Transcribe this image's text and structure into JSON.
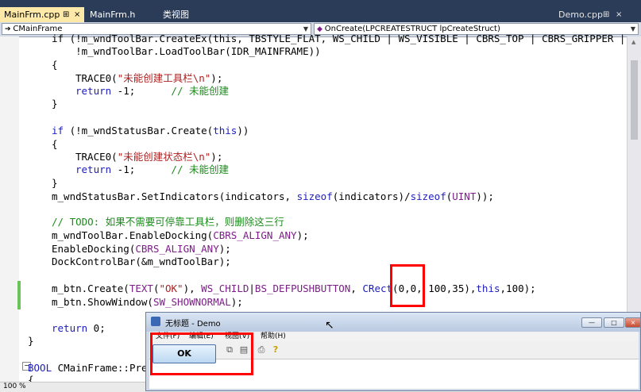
{
  "tabs": [
    {
      "label": "MainFrm.cpp",
      "pin": "⊞",
      "close": "×"
    },
    {
      "label": "MainFrm.h"
    },
    {
      "label": "类视图"
    }
  ],
  "file_tab": {
    "label": "Demo.cpp",
    "pin": "⊞",
    "close": "×"
  },
  "nav": {
    "class_combo": "CMainFrame",
    "method_combo": "OnCreate(LPCREATESTRUCT lpCreateStruct)"
  },
  "code": {
    "l0": "if (!m_wndToolBar.CreateEx(this, TBSTYLE_FLAT, WS_CHILD | WS_VISIBLE | CBRS_TOP | CBRS_GRIPPER |",
    "l1": "    !m_wndToolBar.LoadToolBar(IDR_MAINFRAME))",
    "l2": "{",
    "l3_fn": "TRACE0(",
    "l3_str": "\"未能创建工具栏\\n\"",
    "l3_end": ");",
    "l4_kw": "return",
    "l4_rest": " -1;      ",
    "l4_cm": "// 未能创建",
    "l5": "}",
    "l7_kw": "if",
    "l7_a": " (!m_wndStatusBar.Create(",
    "l7_this": "this",
    "l7_b": "))",
    "l8": "{",
    "l9_fn": "TRACE0(",
    "l9_str": "\"未能创建状态栏\\n\"",
    "l9_end": ");",
    "l10_kw": "return",
    "l10_rest": " -1;      ",
    "l10_cm": "// 未能创建",
    "l11": "}",
    "l12_a": "m_wndStatusBar.SetIndicators(indicators, ",
    "l12_kw1": "sizeof",
    "l12_b": "(indicators)/",
    "l12_kw2": "sizeof",
    "l12_c": "(",
    "l12_mc": "UINT",
    "l12_d": "));",
    "l14_cm": "// TODO: 如果不需要可停靠工具栏，则删除这三行",
    "l15_a": "m_wndToolBar.EnableDocking(",
    "l15_mc": "CBRS_ALIGN_ANY",
    "l15_b": ");",
    "l16_a": "EnableDocking(",
    "l16_mc": "CBRS_ALIGN_ANY",
    "l16_b": ");",
    "l17": "DockControlBar(&m_wndToolBar);",
    "l19_a": "m_btn.Create(",
    "l19_mc1": "TEXT",
    "l19_b": "(",
    "l19_str": "\"OK\"",
    "l19_c": "), ",
    "l19_mc2": "WS_CHILD",
    "l19_d": "|",
    "l19_mc3": "BS_DEFPUSHBUTTON",
    "l19_e": ", ",
    "l19_kw": "CRect",
    "l19_f": "(0,0, 100,35),",
    "l19_this": "this",
    "l19_g": ",100);",
    "l20_a": "m_btn.ShowWindow(",
    "l20_mc": "SW_SHOWNORMAL",
    "l20_b": ");",
    "l22_kw": "return",
    "l22_rest": " 0;",
    "l23": "}",
    "l25_kw": "BOOL",
    "l25_rest": " CMainFrame::Pre",
    "l26": "{"
  },
  "demo_window": {
    "title": "无标题 - Demo",
    "menu": [
      "文件(F)",
      "编辑(E)",
      "视图(V)",
      "帮助(H)"
    ],
    "ok_button": "OK",
    "min": "—",
    "max": "□",
    "close": "×"
  },
  "zoom": "100 %"
}
